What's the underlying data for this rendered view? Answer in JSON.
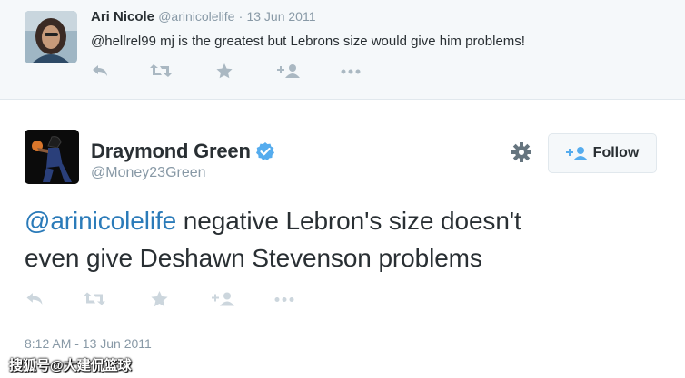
{
  "reply": {
    "name": "Ari Nicole",
    "handle": "@arinicolelife",
    "separator": "·",
    "date": "13 Jun 2011",
    "text": "@hellrel99 mj is the greatest but Lebrons size would give him problems!",
    "actions": [
      "reply-icon",
      "retweet-icon",
      "favorite-icon",
      "follow-icon",
      "more-icon"
    ]
  },
  "tweet": {
    "name": "Draymond Green",
    "verified": true,
    "handle": "@Money23Green",
    "follow_label": "Follow",
    "mention": "@arinicolelife",
    "text_line1_rest": " negative Lebron's size doesn't",
    "text_line2": "even give Deshawn Stevenson problems",
    "timestamp": "8:12 AM - 13 Jun 2011",
    "actions": [
      "reply-icon",
      "retweet-icon",
      "favorite-icon",
      "follow-icon",
      "more-icon"
    ]
  },
  "watermark": "搜狐号@大建侃篮球",
  "colors": {
    "link": "#2b7bb9",
    "muted": "#8899a6",
    "text": "#292f33",
    "verified": "#55acee",
    "background_reply": "#f5f8fa"
  }
}
